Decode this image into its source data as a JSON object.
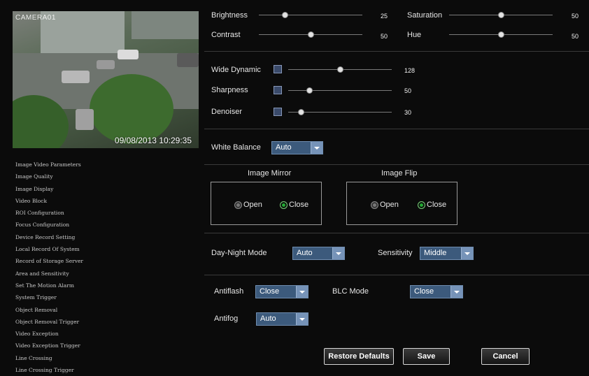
{
  "preview": {
    "camera_name": "CAMERA01",
    "timestamp": "09/08/2013 10:29:35"
  },
  "sidebar": {
    "items": [
      "Image Video Parameters",
      "Image Quality",
      "Image Display",
      "Video Block",
      "ROI Configuration",
      "Focus Configuration",
      "Device Record Setting",
      "Local Record Of System",
      "Record of Storage Server",
      "Area and Sensitivity",
      "Set The Motion Alarm",
      "System Trigger",
      "Object Removal",
      "Object Removal Trigger",
      "Video Exception",
      "Video Exception Trigger",
      "Line Crossing",
      "Line Crossing Trigger"
    ]
  },
  "image": {
    "brightness": {
      "label": "Brightness",
      "value": "25",
      "level": 0.25
    },
    "saturation": {
      "label": "Saturation",
      "value": "50",
      "level": 0.5
    },
    "contrast": {
      "label": "Contrast",
      "value": "50",
      "level": 0.5
    },
    "hue": {
      "label": "Hue",
      "value": "50",
      "level": 0.5
    }
  },
  "enhance": {
    "wide_dynamic": {
      "label": "Wide Dynamic",
      "value": "128",
      "level": 0.5
    },
    "sharpness": {
      "label": "Sharpness",
      "value": "50",
      "level": 0.2
    },
    "denoiser": {
      "label": "Denoiser",
      "value": "30",
      "level": 0.12
    }
  },
  "white_balance": {
    "label": "White Balance",
    "value": "Auto"
  },
  "mirror": {
    "title": "Image Mirror",
    "open": "Open",
    "close": "Close",
    "selected": "Close"
  },
  "flip": {
    "title": "Image Flip",
    "open": "Open",
    "close": "Close",
    "selected": "Close"
  },
  "day_night": {
    "label": "Day-Night Mode",
    "value": "Auto",
    "sensitivity_label": "Sensitivity",
    "sensitivity_value": "Middle"
  },
  "antiflash": {
    "label": "Antiflash",
    "value": "Close"
  },
  "blc": {
    "label": "BLC Mode",
    "value": "Close"
  },
  "antifog": {
    "label": "Antifog",
    "value": "Auto"
  },
  "buttons": {
    "restore": "Restore Defaults",
    "save": "Save",
    "cancel": "Cancel"
  },
  "colors": {
    "accent": "#3c5a7c",
    "radio_selected": "#22aa33"
  }
}
